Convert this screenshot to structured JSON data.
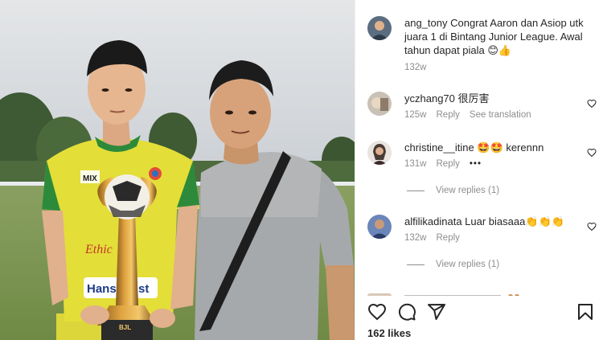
{
  "post": {
    "likes_text": "162 likes"
  },
  "comments": [
    {
      "username": "ang_tony",
      "text": "Congrat Aaron dan Asiop utk juara 1 di Bintang Junior League. Awal tahun dapat piala 😊👍",
      "time": "132w",
      "reply_label": "",
      "translation_label": "",
      "avatar": "avatar-ang-tony"
    },
    {
      "username": "yczhang70",
      "text": "很厉害",
      "time": "125w",
      "reply_label": "Reply",
      "translation_label": "See translation",
      "avatar": "avatar-yczhang70"
    },
    {
      "username": "christine__itine",
      "text": "🤩🤩 kerennn",
      "time": "131w",
      "reply_label": "Reply",
      "more_label": "•••",
      "view_replies": "View replies (1)",
      "avatar": "avatar-christine"
    },
    {
      "username": "alfilikadinata",
      "text": "Luar biasaaa👏👏👏",
      "time": "132w",
      "reply_label": "Reply",
      "view_replies": "View replies (1)",
      "avatar": "avatar-alfilikadinata"
    }
  ],
  "photo": {
    "jersey_text_1": "Ethic",
    "jersey_text_2": "Hanse",
    "jersey_text_3": "st",
    "jersey_brand": "MIX",
    "trophy_text": "BJL"
  },
  "icons": {
    "like": "heart-icon",
    "comment": "comment-icon",
    "share": "send-icon",
    "save": "bookmark-icon"
  },
  "colors": {
    "text": "#262626",
    "secondary": "#8e8e8e",
    "jersey": "#e7e23a",
    "jersey_trim": "#2e8b3a"
  }
}
